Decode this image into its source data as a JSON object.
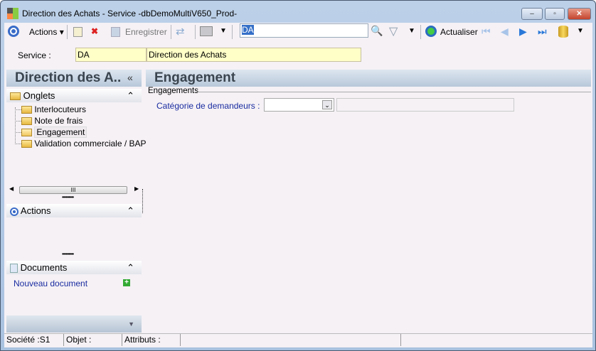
{
  "window": {
    "title": "Direction des Achats -  Service -dbDemoMultiV650_Prod-",
    "minimize": "–",
    "maximize": "▫",
    "close": "✕"
  },
  "toolbar": {
    "actions_label": "Actions",
    "save_label": "Enregistrer",
    "search_value": "DA",
    "refresh_label": "Actualiser"
  },
  "service": {
    "label": "Service :",
    "code": "DA",
    "name": "Direction des Achats"
  },
  "left": {
    "title": "Direction des A..",
    "collapse": "«",
    "tabs_section": {
      "label": "Onglets",
      "items": [
        "Interlocuteurs",
        "Note de frais",
        "Engagement",
        "Validation commerciale / BAP"
      ]
    },
    "actions_section": {
      "label": "Actions"
    },
    "documents_section": {
      "label": "Documents",
      "new_document": "Nouveau document"
    },
    "scroll_grip": "III"
  },
  "main": {
    "title": "Engagement",
    "group_label": "Engagements",
    "category_label": "Catégorie de demandeurs :",
    "category_value": "",
    "category_text": ""
  },
  "statusbar": {
    "company": "Société :S1",
    "object": "Objet :",
    "attributes": "Attributs :"
  }
}
